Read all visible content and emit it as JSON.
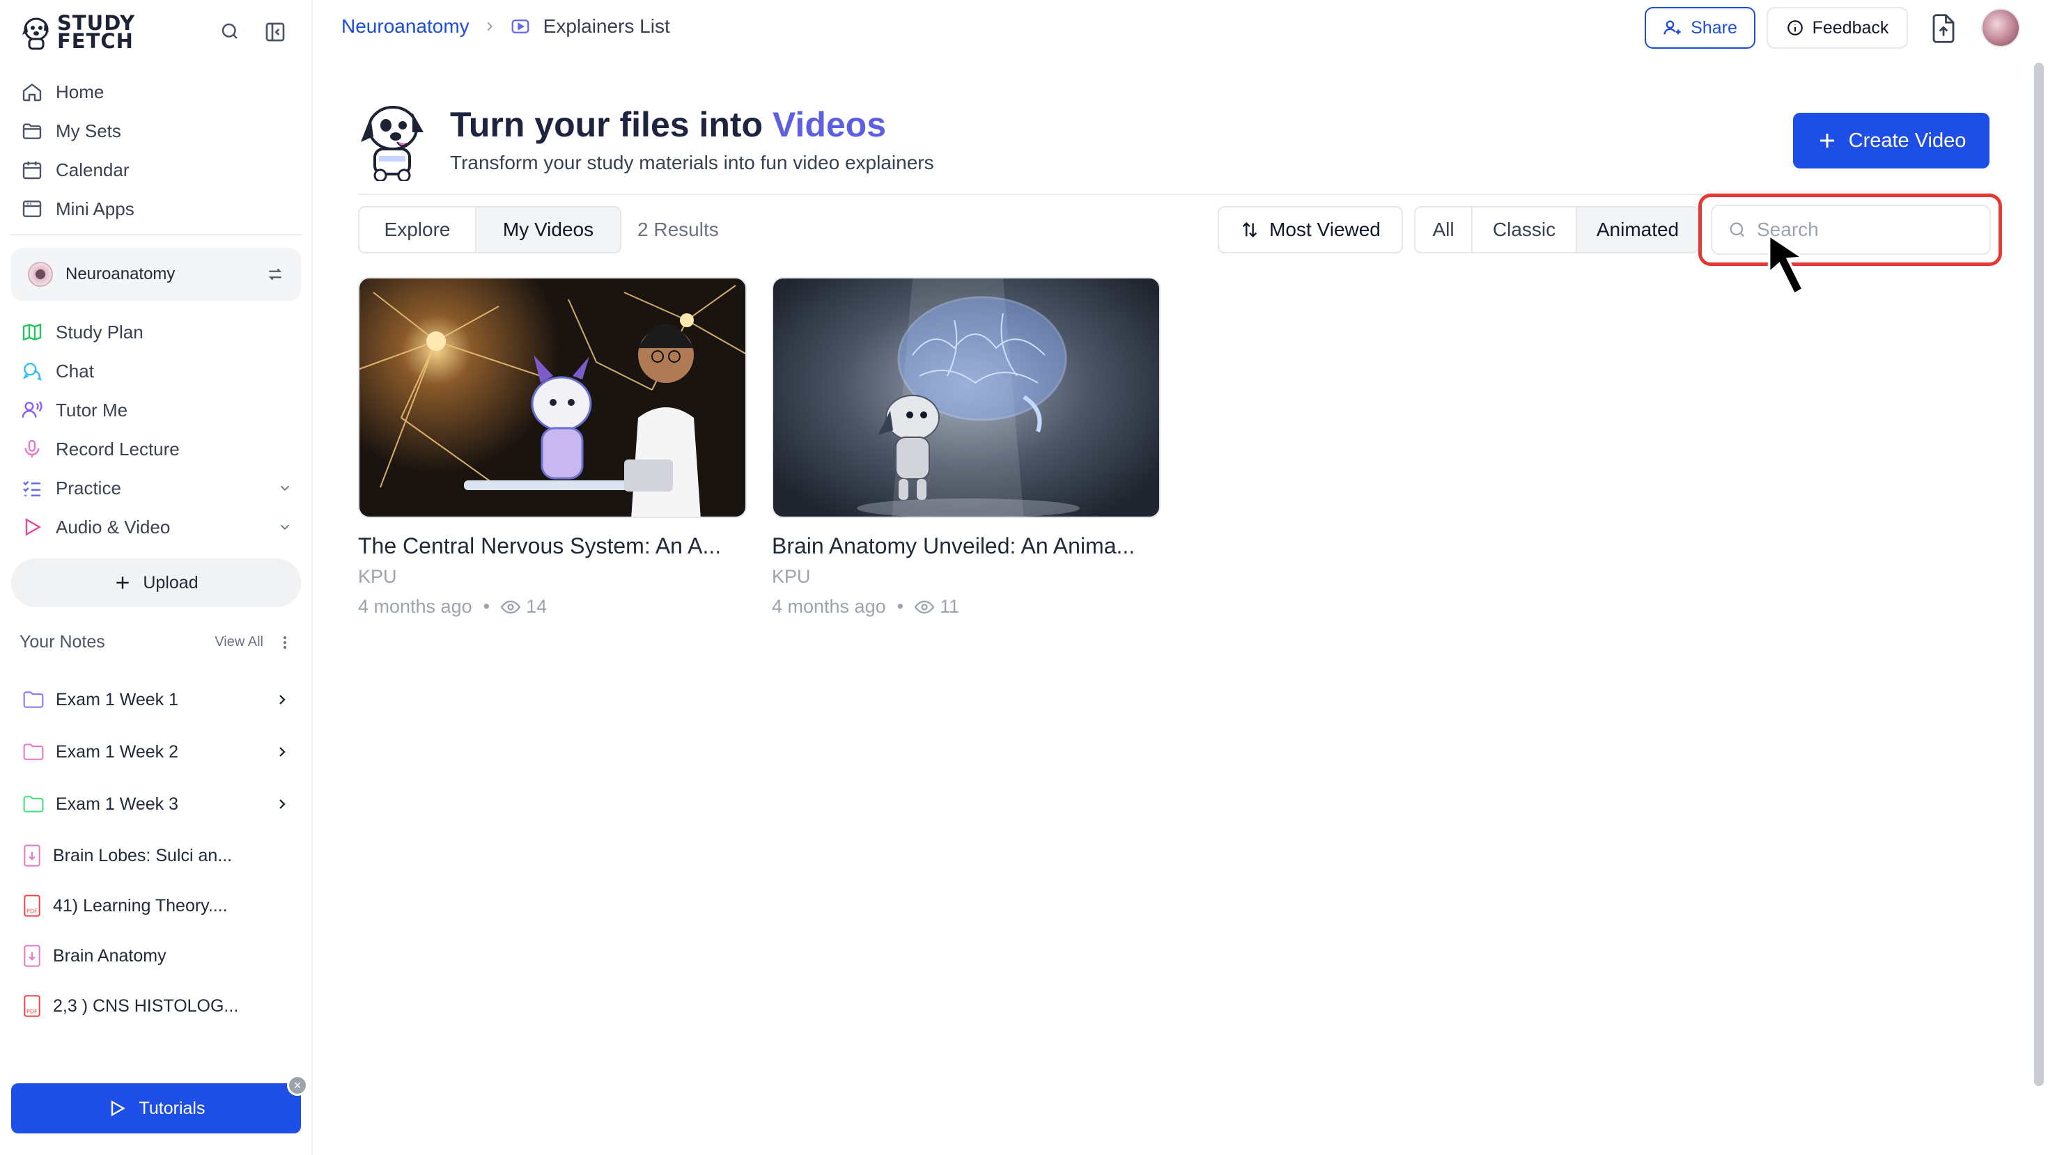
{
  "sidebar": {
    "logo_line1": "STUDY",
    "logo_line2": "FETCH",
    "nav": [
      {
        "label": "Home",
        "icon": "home-icon"
      },
      {
        "label": "My Sets",
        "icon": "folder-icon"
      },
      {
        "label": "Calendar",
        "icon": "calendar-icon"
      },
      {
        "label": "Mini Apps",
        "icon": "app-window-icon"
      }
    ],
    "current_set": "Neuroanatomy",
    "tools": [
      {
        "label": "Study Plan",
        "icon": "map-icon"
      },
      {
        "label": "Chat",
        "icon": "chat-icon"
      },
      {
        "label": "Tutor Me",
        "icon": "tutor-icon"
      },
      {
        "label": "Record Lecture",
        "icon": "microphone-icon"
      },
      {
        "label": "Practice",
        "icon": "list-checks-icon"
      },
      {
        "label": "Audio & Video",
        "icon": "play-icon"
      }
    ],
    "upload_label": "Upload",
    "notes_heading": "Your Notes",
    "view_all": "View All",
    "notes": [
      {
        "label": "Exam 1 Week 1",
        "type": "folder",
        "color": "#8b7cf6"
      },
      {
        "label": "Exam 1 Week 2",
        "type": "folder",
        "color": "#e879c6"
      },
      {
        "label": "Exam 1 Week 3",
        "type": "folder",
        "color": "#4ade80"
      },
      {
        "label": "Brain Lobes: Sulci an...",
        "type": "doc"
      },
      {
        "label": "41) Learning Theory....",
        "type": "pdf"
      },
      {
        "label": "Brain Anatomy",
        "type": "doc"
      },
      {
        "label": "2,3 ) CNS HISTOLOG...",
        "type": "pdf"
      }
    ],
    "tutorials_label": "Tutorials",
    "tutorials_close": "×"
  },
  "header": {
    "breadcrumb_root": "Neuroanatomy",
    "breadcrumb_current": "Explainers List",
    "share_label": "Share",
    "feedback_label": "Feedback"
  },
  "hero": {
    "title_prefix": "Turn your files into",
    "title_accent": "Videos",
    "subtitle": "Transform your study materials into fun video explainers",
    "create_label": "Create Video"
  },
  "toolbar": {
    "tabs": [
      "Explore",
      "My Videos"
    ],
    "active_tab": "My Videos",
    "results": "2 Results",
    "sort_label": "Most Viewed",
    "filters": [
      "All",
      "Classic",
      "Animated"
    ],
    "active_filter": "Animated",
    "search_placeholder": "Search"
  },
  "videos": [
    {
      "title": "The Central Nervous System: An A...",
      "author": "KPU",
      "age": "4 months ago",
      "views": "14"
    },
    {
      "title": "Brain Anatomy Unveiled: An Anima...",
      "author": "KPU",
      "age": "4 months ago",
      "views": "11"
    }
  ],
  "colors": {
    "accent": "#5d5fe0",
    "primary": "#1d4ee5",
    "highlight": "#e53935"
  }
}
